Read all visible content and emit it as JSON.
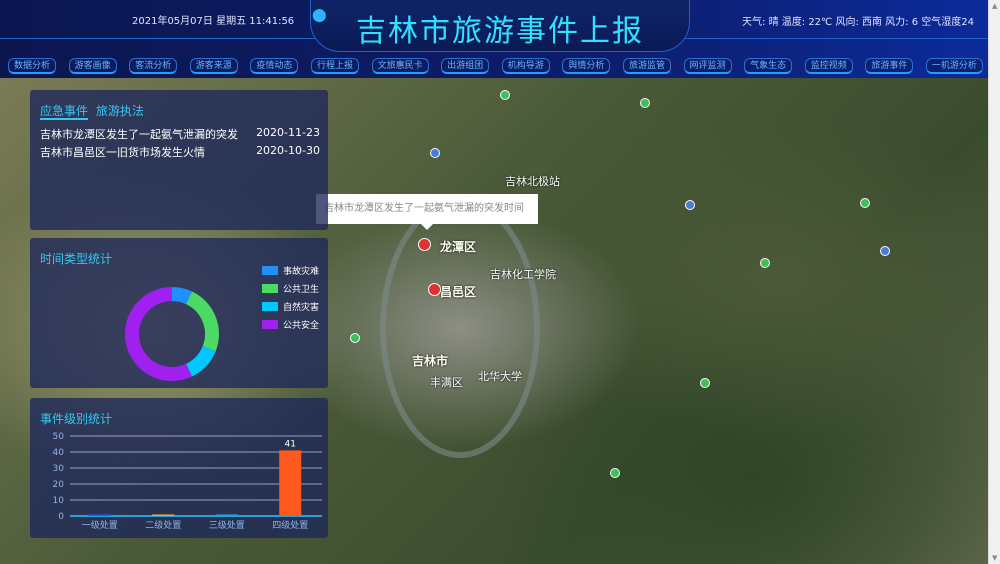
{
  "header": {
    "title": "吉林市旅游事件上报",
    "datetime": "2021年05月07日 星期五 11:41:56",
    "weather": "天气: 晴 温度: 22℃ 风向: 西南 风力: 6 空气湿度24"
  },
  "nav": [
    "数据分析",
    "游客画像",
    "客流分析",
    "游客来源",
    "疫情动态",
    "行程上报",
    "文旅惠民卡",
    "出游组团",
    "机构导游",
    "舆情分析",
    "旅游监管",
    "网评监测",
    "气象生态",
    "监控视频",
    "旅游事件",
    "一机游分析"
  ],
  "events_panel": {
    "tab_active": "应急事件",
    "tab_other": "旅游执法",
    "items": [
      {
        "text": "吉林市龙潭区发生了一起氨气泄漏的突发",
        "date": "2020-11-23"
      },
      {
        "text": "吉林市昌邑区一旧货市场发生火情",
        "date": "2020-10-30"
      }
    ]
  },
  "map": {
    "tooltip": "吉林市龙潭区发生了一起氨气泄漏的突发时间",
    "labels": [
      "龙潭区",
      "昌邑区",
      "吉林市",
      "丰满区",
      "吉林北极站",
      "吉林化工学院",
      "北华大学"
    ]
  },
  "chart_data": [
    {
      "type": "pie",
      "title": "时间类型统计",
      "categories": [
        "事故灾难",
        "公共卫生",
        "自然灾害",
        "公共安全"
      ],
      "values": [
        7,
        24,
        12,
        57
      ],
      "colors": [
        "#1e90ff",
        "#4cd964",
        "#00c8ff",
        "#a020f0"
      ]
    },
    {
      "type": "bar",
      "title": "事件级别统计",
      "categories": [
        "一级处置",
        "二级处置",
        "三级处置",
        "四级处置"
      ],
      "values": [
        1,
        1,
        1,
        41
      ],
      "ylim": [
        0,
        50
      ],
      "yticks": [
        0,
        10,
        20,
        30,
        40,
        50
      ],
      "data_labels": [
        "",
        "",
        "",
        "41"
      ],
      "colors": [
        "#2a5bd7",
        "#f0a020",
        "#2aa0d7",
        "#ff5a1e"
      ]
    }
  ]
}
